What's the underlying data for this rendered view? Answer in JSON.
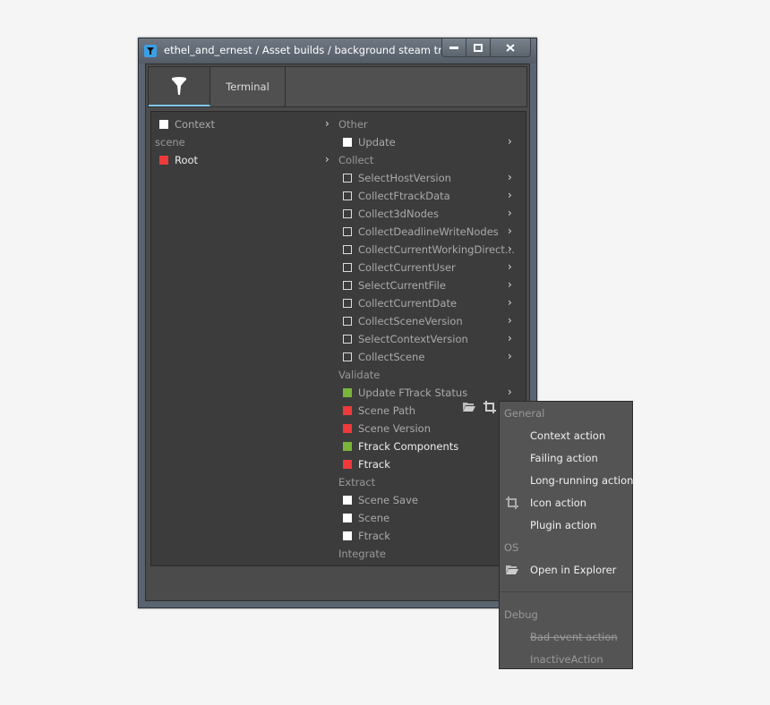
{
  "window": {
    "title": "ethel_and_ernest / Asset builds / background steam trai...",
    "controls": {
      "minimize": "minimize",
      "maximize": "maximize",
      "close": "close"
    }
  },
  "tabs": [
    {
      "label": "",
      "icon": "filter-icon",
      "active": true
    },
    {
      "label": "Terminal",
      "active": false
    }
  ],
  "left_column": {
    "rows": [
      {
        "type": "item",
        "label": "Context",
        "state": "white",
        "chevron": true
      },
      {
        "type": "header",
        "label": "scene"
      },
      {
        "type": "item",
        "label": "Root",
        "state": "red",
        "chevron": true
      }
    ]
  },
  "right_column": {
    "sections": [
      {
        "header": "Other",
        "items": [
          {
            "label": "Update",
            "state": "white",
            "chevron": true
          }
        ]
      },
      {
        "header": "Collect",
        "items": [
          {
            "label": "SelectHostVersion",
            "state": "empty",
            "chevron": true
          },
          {
            "label": "CollectFtrackData",
            "state": "empty",
            "chevron": true
          },
          {
            "label": "Collect3dNodes",
            "state": "empty",
            "chevron": true
          },
          {
            "label": "CollectDeadlineWriteNodes",
            "state": "empty",
            "chevron": true
          },
          {
            "label": "CollectCurrentWorkingDirect...",
            "state": "empty",
            "chevron": true
          },
          {
            "label": "CollectCurrentUser",
            "state": "empty",
            "chevron": true
          },
          {
            "label": "SelectCurrentFile",
            "state": "empty",
            "chevron": true
          },
          {
            "label": "CollectCurrentDate",
            "state": "empty",
            "chevron": true
          },
          {
            "label": "CollectSceneVersion",
            "state": "empty",
            "chevron": true
          },
          {
            "label": "SelectContextVersion",
            "state": "empty",
            "chevron": true
          },
          {
            "label": "CollectScene",
            "state": "empty",
            "chevron": true
          }
        ]
      },
      {
        "header": "Validate",
        "items": [
          {
            "label": "Update FTrack Status",
            "state": "green",
            "chevron": true
          },
          {
            "label": "Scene Path",
            "state": "red",
            "chevron": false
          },
          {
            "label": "Scene Version",
            "state": "red",
            "chevron": false
          },
          {
            "label": "Ftrack Components",
            "state": "green",
            "chevron": false,
            "bright": true
          },
          {
            "label": "Ftrack",
            "state": "red",
            "chevron": false,
            "bright": true
          }
        ]
      },
      {
        "header": "Extract",
        "items": [
          {
            "label": "Scene Save",
            "state": "white",
            "chevron": false
          },
          {
            "label": "Scene",
            "state": "white",
            "chevron": false
          },
          {
            "label": "Ftrack",
            "state": "white",
            "chevron": false
          }
        ]
      },
      {
        "header": "Integrate",
        "items": []
      }
    ]
  },
  "row_actions": {
    "icons": [
      "folder-open-icon",
      "crop-icon"
    ]
  },
  "context_menu": {
    "groups": [
      {
        "header": "General",
        "items": [
          {
            "label": "Context action",
            "icon": null
          },
          {
            "label": "Failing action",
            "icon": null
          },
          {
            "label": "Long-running action",
            "icon": null
          },
          {
            "label": "Icon action",
            "icon": "crop-icon"
          },
          {
            "label": "Plugin action",
            "icon": null
          }
        ]
      },
      {
        "header": "OS",
        "items": [
          {
            "label": "Open in Explorer",
            "icon": "folder-open-icon"
          }
        ]
      },
      {
        "header": "Debug",
        "items": [
          {
            "label": "Bad event action",
            "icon": null,
            "style": "strikethrough"
          },
          {
            "label": "InactiveAction",
            "icon": null,
            "style": "inactive"
          }
        ]
      }
    ]
  },
  "colors": {
    "red": "#ee3a3a",
    "green": "#78b53a",
    "white": "#ffffff",
    "accent": "#7ec8f0"
  }
}
